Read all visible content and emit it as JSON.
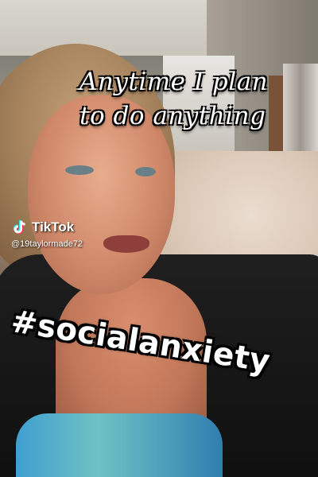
{
  "caption": {
    "line1": "Anytime I plan",
    "line2": "to do anything"
  },
  "watermark": {
    "brand": "TikTok",
    "handle": "@19taylormade72",
    "logo_icon": "tiktok-note-icon"
  },
  "hashtag": {
    "text": "#socialanxiety"
  },
  "colors": {
    "caption_text": "#ffffff",
    "text_outline": "#000000",
    "tiktok_cyan": "#25f4ee",
    "tiktok_red": "#fe2c55"
  }
}
